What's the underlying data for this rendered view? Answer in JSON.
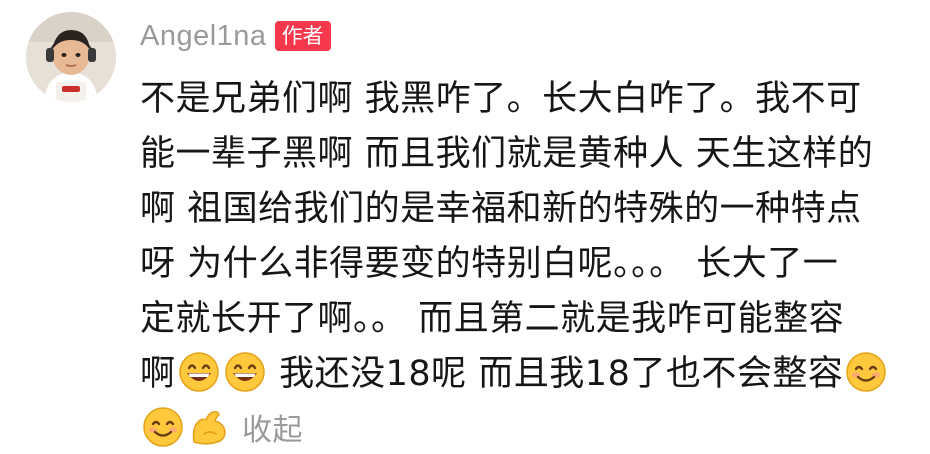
{
  "comment": {
    "username": "Angel1na",
    "author_badge": "作者",
    "lines": [
      "不是兄弟们啊 我黑咋了。长大白咋了。我不可",
      "能一辈子黑啊 而且我们就是黄种人 天生这样的",
      "啊 祖国给我们的是幸福和新的特殊的一种特点",
      "呀 为什么非得要变的特别白呢。。。 长大了一",
      "定就长开了啊。。 而且第二就是我咋可能整容"
    ],
    "line6_start": "啊",
    "line6_middle": " 我还没18呢 而且我18了也不会整容",
    "collapse_label": "收起",
    "emojis": {
      "grin": "grinning-face-icon",
      "smile": "smiling-face-icon",
      "strong": "flexed-biceps-icon"
    },
    "colors": {
      "badge": "#f5384b",
      "username": "#9a9a9a",
      "text": "#161616",
      "emoji_yellow": "#ffc83d"
    }
  }
}
